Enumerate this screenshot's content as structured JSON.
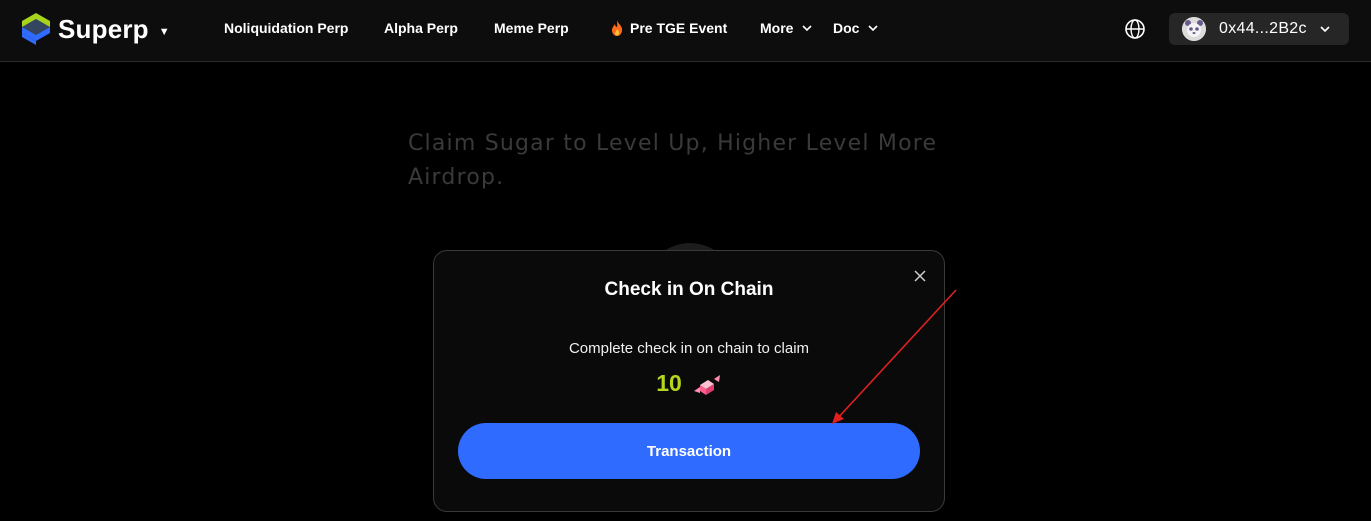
{
  "header": {
    "logo_text": "Superp",
    "nav": [
      {
        "label": "Noliquidation Perp"
      },
      {
        "label": "Alpha Perp"
      },
      {
        "label": "Meme Perp"
      },
      {
        "label": "Pre TGE Event",
        "icon": "fire-icon"
      },
      {
        "label": "More",
        "icon": "chevron-down-icon"
      },
      {
        "label": "Doc",
        "icon": "chevron-down-icon"
      }
    ],
    "language_icon": "globe-icon",
    "wallet": {
      "address": "0x44...2B2c",
      "avatar_icon": "panda-avatar"
    }
  },
  "page": {
    "tagline": "Claim Sugar to Level Up, Higher Level More Airdrop."
  },
  "modal": {
    "title": "Check in On Chain",
    "description": "Complete check in on chain to claim",
    "reward_value": "10",
    "reward_icon": "candy-icon",
    "button_label": "Transaction",
    "close_icon": "close-icon"
  },
  "colors": {
    "accent_blue": "#2f6bff",
    "reward_green": "#b5d61c",
    "logo_green": "#a8d41c",
    "logo_blue": "#2f6bff",
    "annotation_red": "#e02020"
  }
}
